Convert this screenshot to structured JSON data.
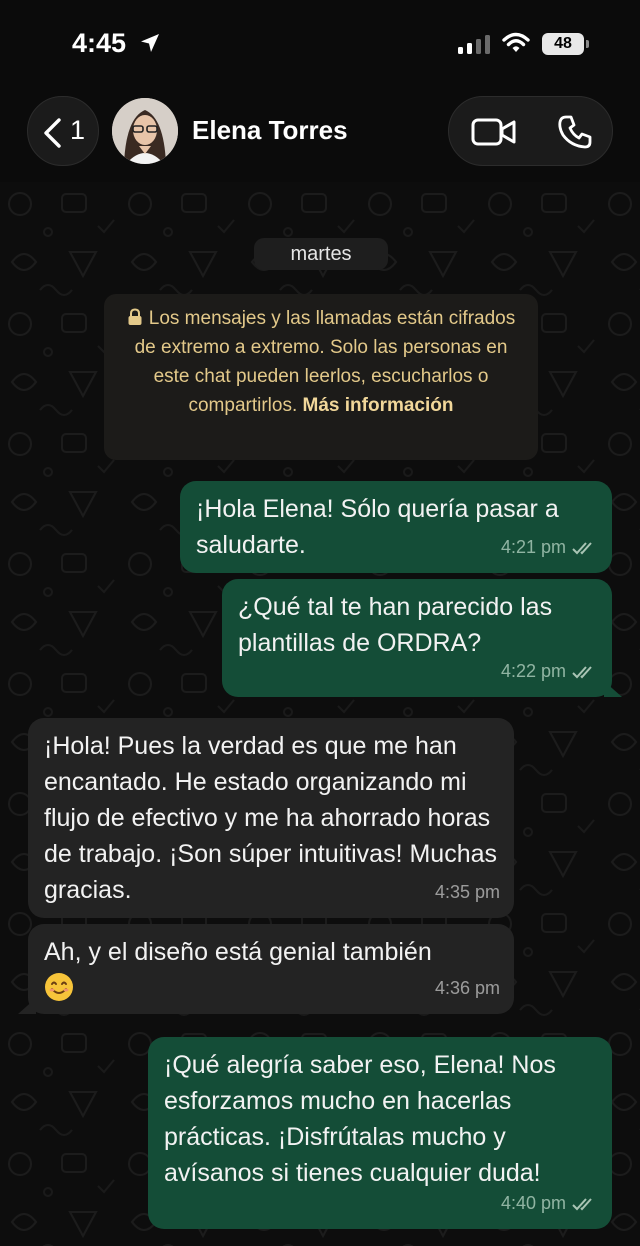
{
  "status_bar": {
    "time": "4:45",
    "battery": "48"
  },
  "header": {
    "back_count": "1",
    "contact_name": "Elena Torres"
  },
  "chat": {
    "date_label": "martes",
    "encryption_notice": "Los mensajes y las llamadas están cifrados de extremo a extremo. Solo las personas en este chat pueden leerlos, escucharlos o compartirlos.",
    "encryption_link": "Más información",
    "messages": [
      {
        "direction": "outgoing",
        "text": "¡Hola Elena! Sólo quería pasar a saludarte.",
        "time": "4:21 pm"
      },
      {
        "direction": "outgoing",
        "text": "¿Qué tal te han parecido las plantillas de ORDRA?",
        "time": "4:22 pm"
      },
      {
        "direction": "incoming",
        "text": "¡Hola! Pues la verdad es que me han encantado. He estado organizando mi flujo de efectivo y me ha ahorrado horas de trabajo. ¡Son súper intuitivas! Muchas gracias.",
        "time": "4:35 pm"
      },
      {
        "direction": "incoming",
        "text": "Ah, y el diseño está genial también",
        "emoji": "smiling-face",
        "time": "4:36 pm"
      },
      {
        "direction": "outgoing",
        "text": "¡Qué alegría saber eso, Elena! Nos esforzamos mucho en hacerlas prácticas. ¡Disfrútalas mucho y avísanos si tienes cualquier duda!",
        "time": "4:40 pm"
      }
    ]
  },
  "colors": {
    "outgoing_bubble": "#144d37",
    "incoming_bubble": "#232323",
    "notice_text": "#e3c98a",
    "read_ticks": "#a9c4b4"
  }
}
